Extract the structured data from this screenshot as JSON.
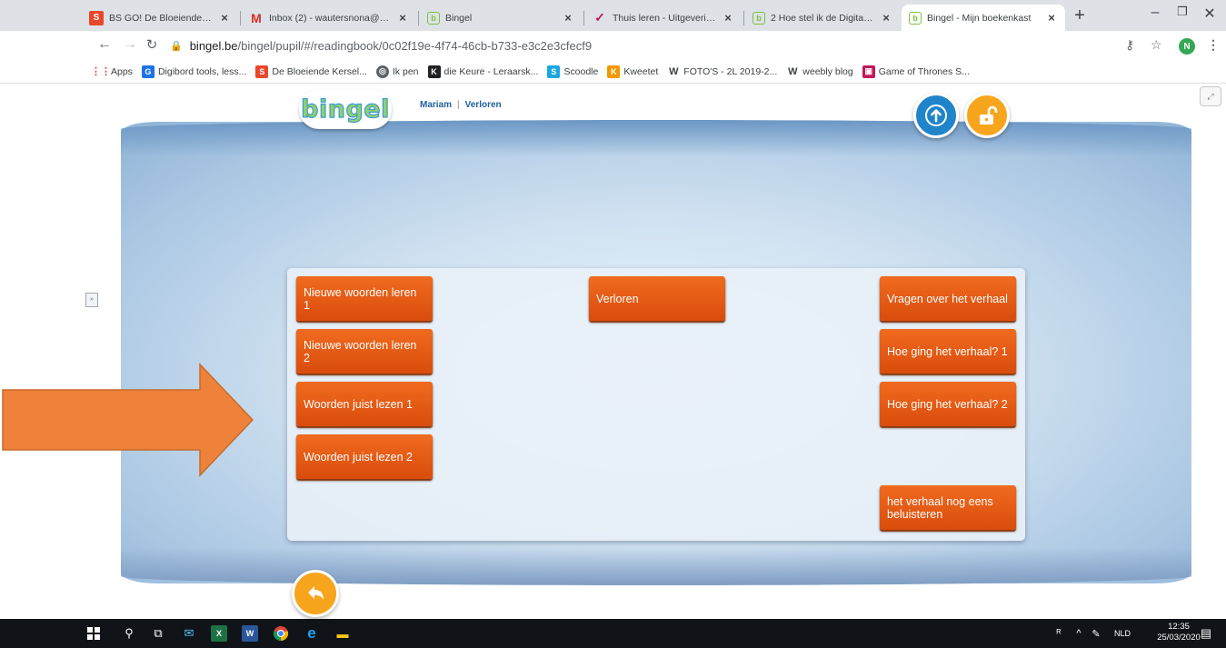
{
  "browser": {
    "tabs": [
      {
        "title": "BS GO! De Bloeiende Kersela",
        "favicon": "s-logo-icon"
      },
      {
        "title": "Inbox (2) - wautersnona@gm",
        "favicon": "gmail-icon"
      },
      {
        "title": "Bingel",
        "favicon": "bingel-icon"
      },
      {
        "title": "Thuis leren - Uitgeverij VAN",
        "favicon": "checkmark-icon"
      },
      {
        "title": "2 Hoe stel ik de Digitale boe",
        "favicon": "bingel-icon"
      },
      {
        "title": "Bingel - Mijn boekenkast",
        "favicon": "bingel-icon"
      }
    ],
    "active_tab_index": 5,
    "url_host": "bingel.be",
    "url_path": "/bingel/pupil/#/readingbook/0c02f19e-4f74-46cb-b733-e3c2e3cfecf9",
    "profile_initial": "N",
    "bookmarks": [
      {
        "label": "Apps",
        "icon": "apps-grid-icon",
        "color": "#e8472c"
      },
      {
        "label": "Digibord tools, less...",
        "icon": "g-logo-icon",
        "color": "#1a73e8"
      },
      {
        "label": "De Bloeiende Kersel...",
        "icon": "s-logo-icon",
        "color": "#e8472c"
      },
      {
        "label": "Ik pen",
        "icon": "globe-icon",
        "color": "#5f6368"
      },
      {
        "label": "die Keure - Leraarsk...",
        "icon": "keure-icon",
        "color": "#202124"
      },
      {
        "label": "Scoodle",
        "icon": "scoodle-icon",
        "color": "#1aa7e0"
      },
      {
        "label": "Kweetet",
        "icon": "kweetet-icon",
        "color": "#f29900"
      },
      {
        "label": "FOTO'S - 2L 2019-2...",
        "icon": "weebly-icon",
        "color": "#3c4043"
      },
      {
        "label": "weebly blog",
        "icon": "weebly-icon",
        "color": "#3c4043"
      },
      {
        "label": "Game of Thrones S...",
        "icon": "tv-icon",
        "color": "#c2185b"
      }
    ]
  },
  "app": {
    "logo": "bingel",
    "breadcrumb": {
      "user": "Mariam",
      "separator": "|",
      "book": "Verloren"
    },
    "left_column": [
      "Nieuwe woorden leren 1",
      "Nieuwe woorden leren 2",
      "Woorden juist lezen 1",
      "Woorden juist lezen 2"
    ],
    "middle_column": [
      "Verloren"
    ],
    "right_column": [
      "Vragen over het verhaal",
      "Hoe ging het verhaal? 1",
      "Hoe ging het verhaal? 2"
    ],
    "bottom_right": "het verhaal nog eens beluisteren",
    "colors": {
      "button": "#e8590f",
      "accent_orange": "#f7a51c",
      "accent_blue": "#1f84c9",
      "arrow": "#ee823b"
    }
  },
  "taskbar": {
    "language": "NLD",
    "time": "12:35",
    "date": "25/03/2020"
  }
}
